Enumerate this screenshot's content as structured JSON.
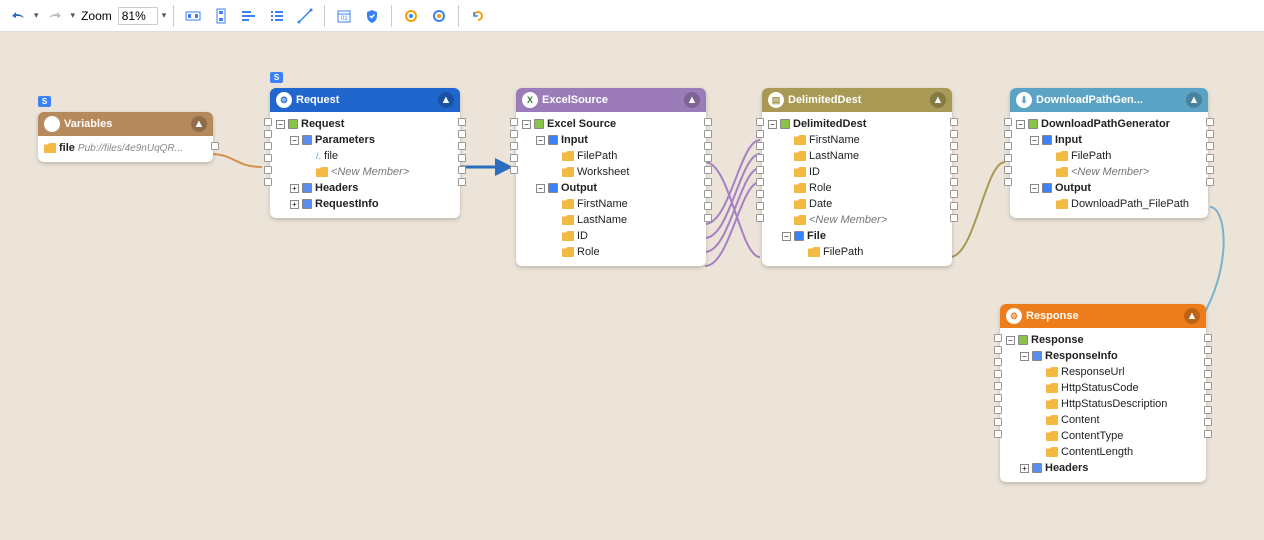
{
  "toolbar": {
    "zoom_label": "Zoom",
    "zoom_value": "81%"
  },
  "badge": "S",
  "nodes": {
    "variables": {
      "title": "Variables",
      "file_label": "file",
      "file_value": "Pub://files/4e9nUqQR..."
    },
    "request": {
      "title": "Request",
      "root": "Request",
      "params": "Parameters",
      "file": "file",
      "newmember": "<New Member>",
      "headers": "Headers",
      "reqinfo": "RequestInfo"
    },
    "excel": {
      "title": "ExcelSource",
      "root": "Excel Source",
      "input": "Input",
      "filepath": "FilePath",
      "worksheet": "Worksheet",
      "output": "Output",
      "firstname": "FirstName",
      "lastname": "LastName",
      "id": "ID",
      "role": "Role"
    },
    "delim": {
      "title": "DelimitedDest",
      "root": "DelimitedDest",
      "firstname": "FirstName",
      "lastname": "LastName",
      "id": "ID",
      "role": "Role",
      "date": "Date",
      "newmember": "<New Member>",
      "file": "File",
      "filepath": "FilePath"
    },
    "download": {
      "title": "DownloadPathGen...",
      "root": "DownloadPathGenerator",
      "input": "Input",
      "filepath": "FilePath",
      "newmember": "<New Member>",
      "output": "Output",
      "dlpath": "DownloadPath_FilePath"
    },
    "response": {
      "title": "Response",
      "root": "Response",
      "respinfo": "ResponseInfo",
      "respurl": "ResponseUrl",
      "status": "HttpStatusCode",
      "statusdesc": "HttpStatusDescription",
      "content": "Content",
      "contenttype": "ContentType",
      "contentlen": "ContentLength",
      "headers": "Headers"
    }
  }
}
